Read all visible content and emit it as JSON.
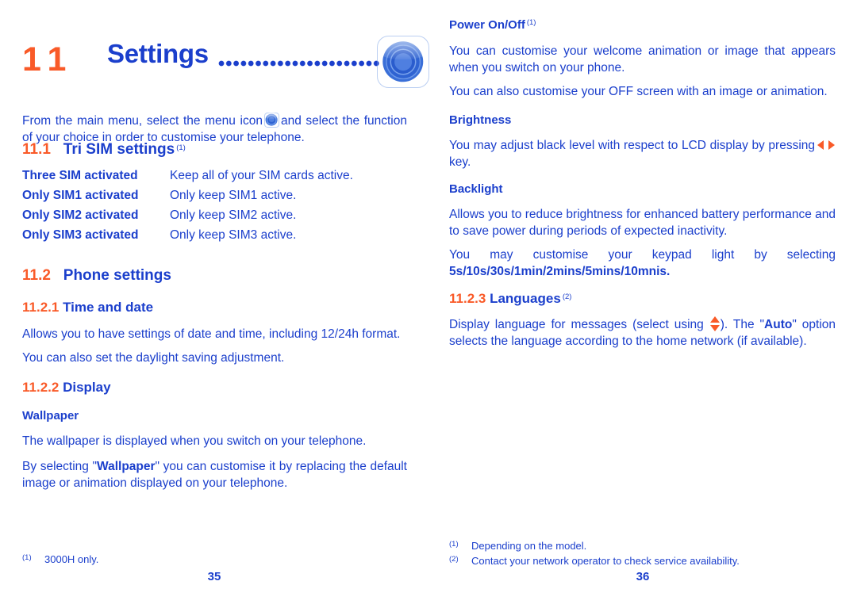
{
  "document": {
    "accent_orange": "#f95a28",
    "accent_blue": "#1b3fcc"
  },
  "left_page": {
    "chapter": {
      "number": "11",
      "title": "Settings",
      "leader": "........................",
      "icon_name": "settings-app-icon"
    },
    "intro": {
      "before_icon": "From the main menu, select the menu icon",
      "after_icon": "and select the function of your choice in order to customise your telephone."
    },
    "section_1": {
      "number": "11.1",
      "title": "Tri SIM settings",
      "footnote_mark": "(1)",
      "items": [
        {
          "term": "Three SIM activated",
          "desc": "Keep all of your SIM cards active."
        },
        {
          "term": "Only SIM1 activated",
          "desc": "Only keep SIM1 active."
        },
        {
          "term": "Only SIM2 activated",
          "desc": "Only keep SIM2 active."
        },
        {
          "term": "Only SIM3 activated",
          "desc": "Only keep SIM3 active."
        }
      ]
    },
    "section_2": {
      "number": "11.2",
      "title": "Phone settings"
    },
    "subsection_1": {
      "number": "11.2.1",
      "title": "Time and date",
      "paragraph_1": "Allows you to have settings of date and time, including 12/24h format.",
      "paragraph_2": "You can also set the daylight saving adjustment."
    },
    "subsection_2": {
      "number": "11.2.2",
      "title": "Display",
      "wallpaper_heading": "Wallpaper",
      "wallpaper_paragraph_1": "The wallpaper is displayed when you switch on your telephone.",
      "wallpaper_paragraph_2_a": "By selecting \"",
      "wallpaper_paragraph_2_bold": "Wallpaper",
      "wallpaper_paragraph_2_b": "\" you can customise it by replacing the default image or animation displayed on your telephone."
    },
    "footnotes": [
      {
        "mark": "(1)",
        "text": "3000H only."
      }
    ],
    "page_number": "35"
  },
  "right_page": {
    "power_heading": "Power On/Off",
    "power_footnote_mark": "(1)",
    "power_paragraph_1": "You can customise your welcome animation or image that appears when you switch on your phone.",
    "power_paragraph_2": "You can also customise your OFF screen with an image or animation.",
    "brightness_heading": "Brightness",
    "brightness_paragraph_a": "You may adjust black level with respect to LCD display by pressing",
    "brightness_paragraph_b": "key.",
    "backlight_heading": "Backlight",
    "backlight_paragraph_1": "Allows you to reduce brightness for enhanced battery performance and to save power during periods of expected inactivity.",
    "backlight_paragraph_2_a": "You may customise your keypad light by selecting",
    "backlight_paragraph_2_bold": "5s/10s/30s/1min/2mins/5mins/10mnis.",
    "subsection_3": {
      "number": "11.2.3",
      "title": "Languages",
      "footnote_mark": "(2)"
    },
    "languages_paragraph_a": "Display language for messages (select using",
    "languages_paragraph_b": "). The \"",
    "languages_paragraph_bold": "Auto",
    "languages_paragraph_c": "\" option selects the language according to the home network (if available).",
    "footnotes": [
      {
        "mark": "(1)",
        "text": "Depending on the model."
      },
      {
        "mark": "(2)",
        "text": "Contact your network operator to check service availability."
      }
    ],
    "page_number": "36"
  }
}
